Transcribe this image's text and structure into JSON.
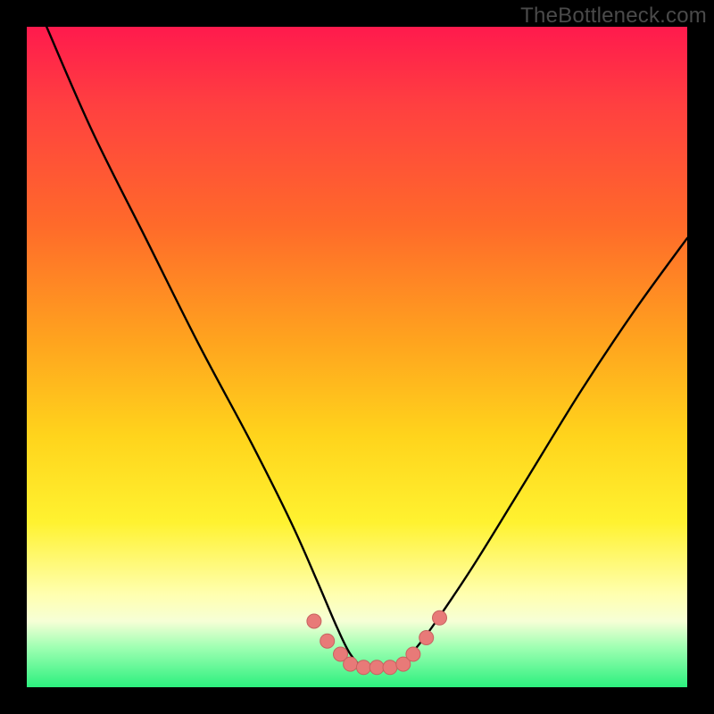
{
  "watermark": {
    "text": "TheBottleneck.com"
  },
  "colors": {
    "curve_stroke": "#000000",
    "marker_fill": "#e87a78",
    "marker_stroke": "#c76360"
  },
  "chart_data": {
    "type": "line",
    "title": "",
    "xlabel": "",
    "ylabel": "",
    "xlim": [
      0,
      100
    ],
    "ylim": [
      0,
      100
    ],
    "grid": false,
    "legend": false,
    "series": [
      {
        "name": "bottleneck-curve",
        "x": [
          3,
          10,
          18,
          26,
          34,
          40,
          44,
          47,
          49,
          51,
          53,
          55,
          57,
          59,
          62,
          68,
          76,
          84,
          92,
          100
        ],
        "y": [
          100,
          84,
          68,
          52,
          37,
          25,
          16,
          9,
          5,
          3,
          3,
          3,
          4,
          6,
          10,
          19,
          32,
          45,
          57,
          68
        ]
      }
    ],
    "markers": {
      "name": "highlight-dots",
      "x": [
        43.5,
        45.5,
        47.5,
        49,
        51,
        53,
        55,
        57,
        58.5,
        60.5,
        62.5
      ],
      "y": [
        10,
        7,
        5,
        3.5,
        3,
        3,
        3,
        3.5,
        5,
        7.5,
        10.5
      ]
    }
  }
}
